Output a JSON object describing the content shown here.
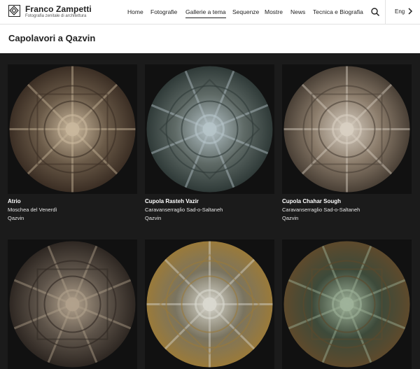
{
  "brand": {
    "title": "Franco Zampetti",
    "subtitle": "Fotografia zenitale di architettura"
  },
  "nav": [
    "Home",
    "Fotografie",
    "Gallerie a tema",
    "Sequenze",
    "Mostre",
    "News",
    "Tecnica e Biografia"
  ],
  "nav_active": "Gallerie a tema",
  "language": "Eng",
  "page_title": "Capolavori a Qazvin",
  "cards": [
    {
      "title": "Atrio",
      "subtitle": "Moschea del Venerdì",
      "city": "Qazvin",
      "palette": [
        "#6a5a48",
        "#c9b79c",
        "#3b2e24"
      ]
    },
    {
      "title": "Cupola Rasteh Vazir",
      "subtitle": "Caravanserraglio Sad-o-Saltaneh",
      "city": "Qazvin",
      "palette": [
        "#5f6a66",
        "#b6c4c9",
        "#2f3a38"
      ]
    },
    {
      "title": "Cupola Chahar Sough",
      "subtitle": "Caravanserraglio Sad-o-Saltaneh",
      "city": "Qazvin",
      "palette": [
        "#8a7b6a",
        "#d8cfc2",
        "#4a4036"
      ]
    },
    {
      "palette": [
        "#5d5349",
        "#b1a18c",
        "#2e2722"
      ]
    },
    {
      "palette": [
        "#7a7460",
        "#d9d8cf",
        "#9a7a3a"
      ]
    },
    {
      "palette": [
        "#3d4a3a",
        "#9fb39a",
        "#5e4a2c"
      ]
    }
  ],
  "colors": {
    "page_bg": "#1b1b1b",
    "header_bg": "#ffffff",
    "text_dark": "#222222"
  }
}
